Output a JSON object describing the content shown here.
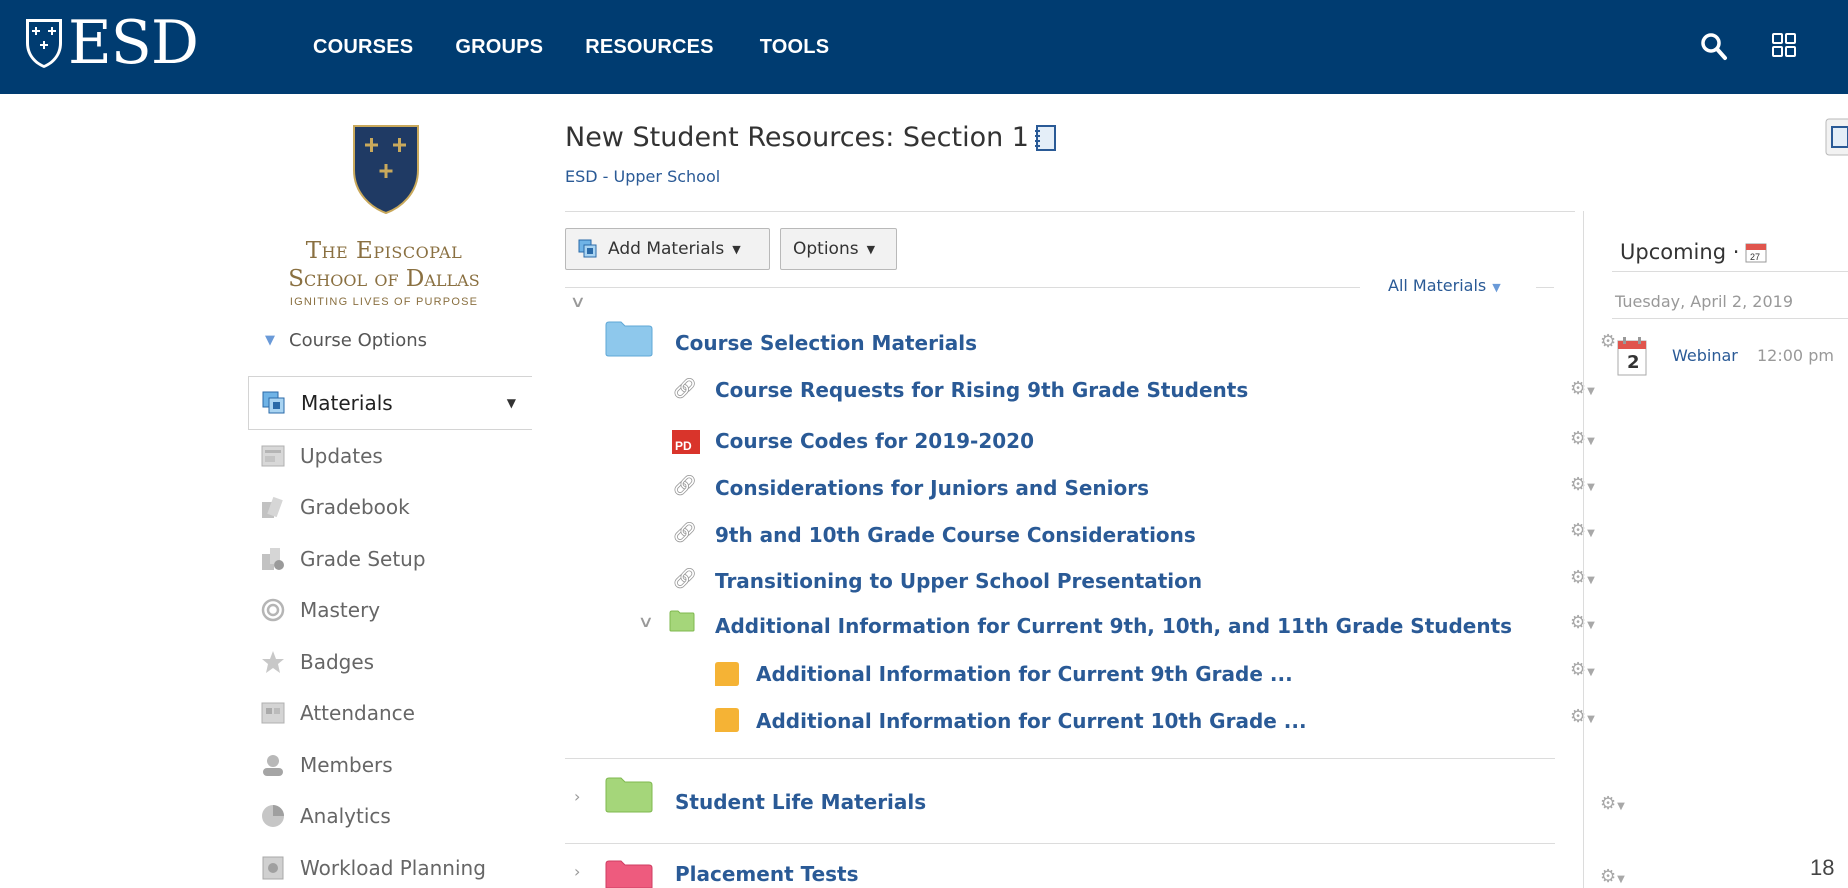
{
  "brand": {
    "logo_text": "ESD"
  },
  "nav": {
    "items": [
      "COURSES",
      "GROUPS",
      "RESOURCES",
      "TOOLS"
    ]
  },
  "school": {
    "line1": "The Episcopal",
    "line2": "School of Dallas",
    "tagline": "IGNITING LIVES OF PURPOSE"
  },
  "sidebar": {
    "course_options": "Course Options",
    "items": [
      {
        "label": "Materials",
        "icon": "materials-icon"
      },
      {
        "label": "Updates",
        "icon": "updates-icon"
      },
      {
        "label": "Gradebook",
        "icon": "gradebook-icon"
      },
      {
        "label": "Grade Setup",
        "icon": "grade-setup-icon"
      },
      {
        "label": "Mastery",
        "icon": "mastery-icon"
      },
      {
        "label": "Badges",
        "icon": "badges-icon"
      },
      {
        "label": "Attendance",
        "icon": "attendance-icon"
      },
      {
        "label": "Members",
        "icon": "members-icon"
      },
      {
        "label": "Analytics",
        "icon": "analytics-icon"
      },
      {
        "label": "Workload Planning",
        "icon": "workload-planning-icon"
      }
    ]
  },
  "page": {
    "title": "New Student Resources: Section 1",
    "subtitle": "ESD - Upper School"
  },
  "toolbar": {
    "add_materials": "Add Materials",
    "options": "Options",
    "filter": "All Materials"
  },
  "materials": {
    "folder1": {
      "title": "Course Selection Materials",
      "items": [
        "Course Requests for Rising 9th Grade Students",
        "Course Codes for 2019-2020",
        "Considerations for Juniors and Seniors",
        "9th and 10th Grade Course Considerations",
        "Transitioning to Upper School Presentation"
      ],
      "subfolder": {
        "title": "Additional Information for Current 9th, 10th, and 11th Grade Students",
        "items": [
          "Additional Information for Current 9th Grade ...",
          "Additional Information for Current 10th Grade ..."
        ]
      }
    },
    "folder2": {
      "title": "Student Life Materials"
    },
    "folder3": {
      "title": "Placement Tests"
    }
  },
  "upcoming": {
    "title": "Upcoming ·",
    "date": "Tuesday, April 2, 2019",
    "event_day": "2",
    "event_title": "Webinar",
    "event_time": "12:00 pm"
  },
  "page_number": "18",
  "colors": {
    "nav_bg": "#003c71",
    "link": "#2a5a96",
    "folder_blue": "#8ec8ec",
    "folder_green": "#a5d67a",
    "folder_pink": "#ee5b7e",
    "doc_orange": "#f5b335",
    "pdf_red": "#d9342b"
  }
}
